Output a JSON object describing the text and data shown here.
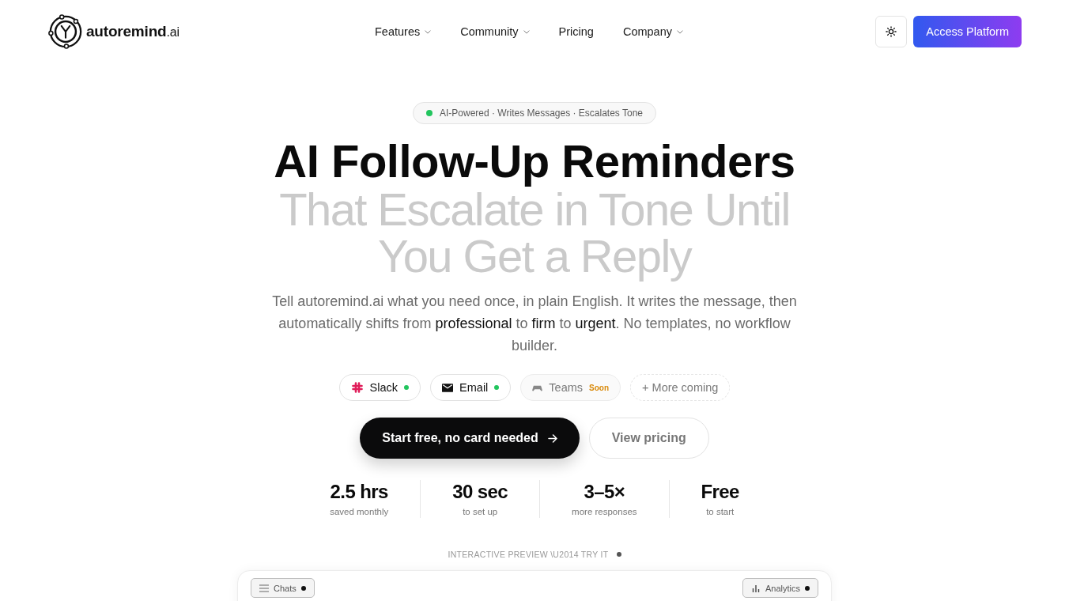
{
  "header": {
    "logo": "**autoremind**.ai",
    "nav": [
      {
        "label": "Features",
        "has_menu": true
      },
      {
        "label": "Community",
        "has_menu": true
      },
      {
        "label": "Pricing",
        "has_menu": false
      },
      {
        "label": "Company",
        "has_menu": true
      }
    ],
    "cta": "Access Platform"
  },
  "hero": {
    "badge": "AI-Powered · Writes Messages · Escalates Tone",
    "headline": "AI Follow-Up Reminders",
    "subheadline": "That Escalate in Tone Until You Get a Reply",
    "description": "Tell autoremind.ai what you need once, in plain English. It writes the message, then automatically shifts from **professional** to **firm** to **urgent**. No templates, no workflow builder.",
    "channels": [
      {
        "name": "Slack",
        "kind": "available"
      },
      {
        "name": "Email",
        "kind": "available"
      },
      {
        "name": "Teams",
        "kind": "soon",
        "tag": "Soon"
      },
      {
        "name": "+ More coming",
        "kind": "more"
      }
    ],
    "primary_button": "Start free, no card needed",
    "secondary_button": "View pricing",
    "stats": [
      {
        "value": "2.5 hrs",
        "label": "saved monthly"
      },
      {
        "value": "30 sec",
        "label": "to set up"
      },
      {
        "value": "3–5×",
        "label": "more responses"
      },
      {
        "value": "Free",
        "label": "to start"
      }
    ]
  },
  "preview": {
    "caption": "INTERACTIVE PREVIEW \\U2014 TRY IT",
    "tabs": [
      {
        "label": "Chats"
      },
      {
        "label": "Analytics"
      }
    ]
  }
}
